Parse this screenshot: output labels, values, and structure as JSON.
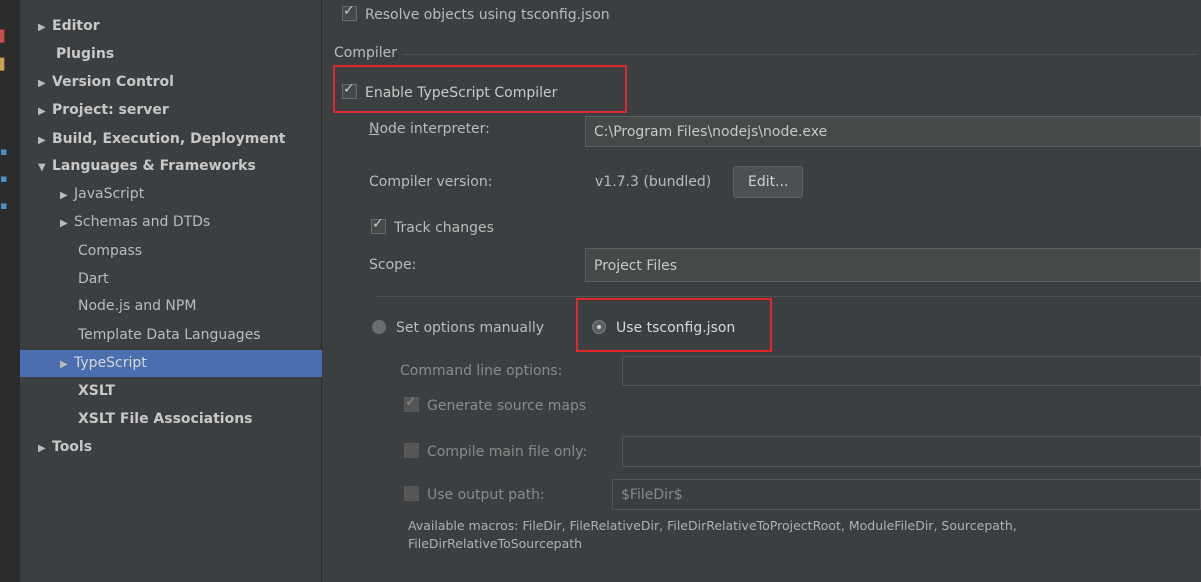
{
  "sidebar": {
    "items": [
      {
        "label": "Editor",
        "arrow": "right"
      },
      {
        "label": "Plugins"
      },
      {
        "label": "Version Control",
        "arrow": "right"
      },
      {
        "label": "Project: server",
        "arrow": "right"
      },
      {
        "label": "Build, Execution, Deployment",
        "arrow": "right"
      },
      {
        "label": "Languages & Frameworks",
        "arrow": "down"
      },
      {
        "label": "JavaScript",
        "arrow": "right"
      },
      {
        "label": "Schemas and DTDs",
        "arrow": "right"
      },
      {
        "label": "Compass"
      },
      {
        "label": "Dart"
      },
      {
        "label": "Node.js and NPM"
      },
      {
        "label": "Template Data Languages"
      },
      {
        "label": "TypeScript",
        "arrow": "right",
        "selected": true
      },
      {
        "label": "XSLT"
      },
      {
        "label": "XSLT File Associations"
      },
      {
        "label": "Tools",
        "arrow": "right"
      }
    ]
  },
  "main": {
    "resolve_objects_label": "Resolve objects using tsconfig.json",
    "compiler_section_title": "Compiler",
    "enable_compiler_label": "Enable TypeScript Compiler",
    "node_interpreter_label_first": "N",
    "node_interpreter_label_rest": "ode interpreter:",
    "node_interpreter_value": "C:\\Program Files\\nodejs\\node.exe",
    "compiler_version_label": "Compiler version:",
    "compiler_version_value": "v1.7.3 (bundled)",
    "edit_button_label": "Edit...",
    "track_changes_label": "Track changes",
    "scope_label": "Scope:",
    "scope_value": "Project Files",
    "set_options_manually_label": "Set options manually",
    "use_tsconfig_label": "Use tsconfig.json",
    "command_line_options_label": "Command line options:",
    "command_line_options_value": "",
    "generate_source_maps_label": "Generate source maps",
    "compile_main_only_label": "Compile main file only:",
    "compile_main_only_value": "",
    "use_output_path_label": "Use output path:",
    "output_path_value": "$FileDir$",
    "macros_line1": "Available macros: FileDir, FileRelativeDir, FileDirRelativeToProjectRoot, ModuleFileDir, Sourcepath,",
    "macros_line2": "FileDirRelativeToSourcepath"
  },
  "colors": {
    "background": "#3c3f41",
    "selection": "#4b6eaf",
    "highlight_box": "#e12727"
  }
}
